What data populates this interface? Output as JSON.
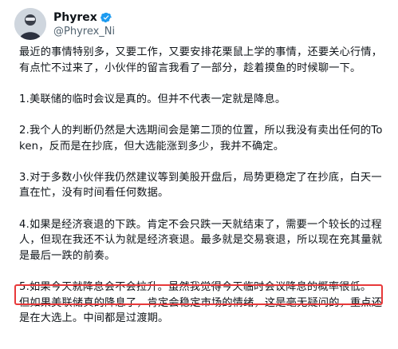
{
  "author": {
    "name": "Phyrex",
    "handle": "@Phyrex_Ni",
    "verified": true,
    "verified_color": "#1d9bf0"
  },
  "tweet": {
    "paragraphs": [
      "最近的事情特别多，又要工作，又要安排花栗鼠上学的事情，还要关心行情，有点忙不过来了，小伙伴的留言我看了一部分，趁着摸鱼的时候聊一下。",
      "1.美联储的临时会议是真的。但并不代表一定就是降息。",
      "2.我个人的判断仍然是大选期间会是第二顶的位置，所以我没有卖出任何的Token，反而是在抄底，但大选能涨到多少，我并不确定。",
      "3.对于多数小伙伴我仍然建议等到美股开盘后，局势更稳定了在抄底，白天一直在忙，没有时间看任何数据。",
      "4.如果是经济衰退的下跌。肯定不会只跌一天就结束了，需要一个较长的过程人，但现在我还不认为就是经济衰退。最多就是交易衰退，所以现在充其量就是最后一跌的前奏。",
      "5.如果今天就降息会不会拉升。虽然我觉得今天临时会议降息的概率很低。",
      "但如果美联储真的降息了，肯定会稳定市场的情绪，这是毫无疑问的，重点还是在大选上。中间都是过渡期。"
    ]
  },
  "highlight": {
    "color": "#e8393a"
  }
}
